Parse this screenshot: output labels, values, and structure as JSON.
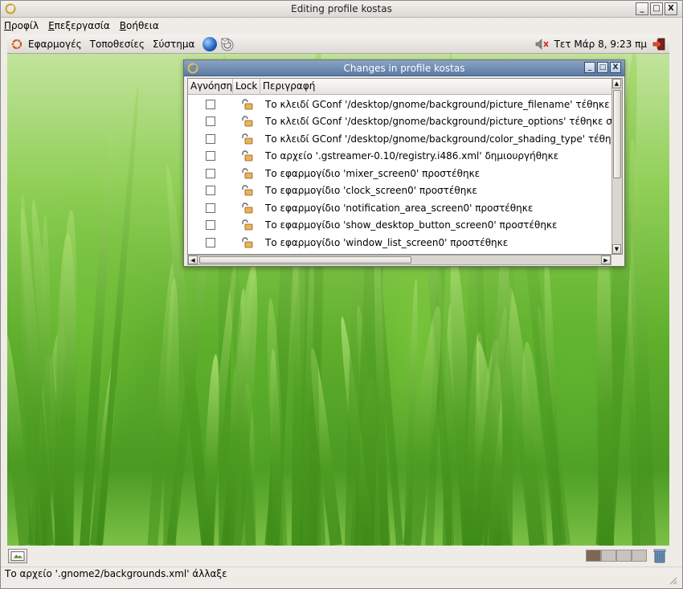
{
  "outer_window": {
    "title": "Editing profile kostas",
    "menu": [
      "Προφίλ",
      "Επεξεργασία",
      "Βοήθεια"
    ],
    "buttons": [
      "_",
      "□",
      "X"
    ]
  },
  "gnome_panel": {
    "menus": [
      "Εφαρμογές",
      "Τοποθεσίες",
      "Σύστημα"
    ],
    "clock": "Τετ Μάρ 8, 9:23 πμ"
  },
  "dialog": {
    "title": "Changes in profile kostas",
    "buttons": [
      "_",
      "□",
      "X"
    ],
    "columns": [
      "Αγνόηση",
      "Lock",
      "Περιγραφή"
    ],
    "rows": [
      {
        "ignored": false,
        "locked": false,
        "description": "Το κλειδί GConf '/desktop/gnome/background/picture_filename' τέθηκε στο '"
      },
      {
        "ignored": false,
        "locked": false,
        "description": "Το κλειδί GConf '/desktop/gnome/background/picture_options' τέθηκε στο '"
      },
      {
        "ignored": false,
        "locked": false,
        "description": "Το κλειδί GConf '/desktop/gnome/background/color_shading_type' τέθηκε σ"
      },
      {
        "ignored": false,
        "locked": false,
        "description": "Το αρχείο '.gstreamer-0.10/registry.i486.xml' δημιουργήθηκε"
      },
      {
        "ignored": false,
        "locked": false,
        "description": "Το εφαρμογίδιο 'mixer_screen0' προστέθηκε"
      },
      {
        "ignored": false,
        "locked": false,
        "description": "Το εφαρμογίδιο 'clock_screen0' προστέθηκε"
      },
      {
        "ignored": false,
        "locked": false,
        "description": "Το εφαρμογίδιο 'notification_area_screen0' προστέθηκε"
      },
      {
        "ignored": false,
        "locked": false,
        "description": "Το εφαρμογίδιο 'show_desktop_button_screen0' προστέθηκε"
      },
      {
        "ignored": false,
        "locked": false,
        "description": "Το εφαρμογίδιο 'window_list_screen0' προστέθηκε"
      }
    ]
  },
  "workspaces": {
    "count": 4,
    "active": 1
  },
  "status_bar": {
    "text": "Το αρχείο '.gnome2/backgrounds.xml' άλλαξε"
  },
  "colors": {
    "dialog_titlebar": "#5a7aa4",
    "window_bg": "#efebe7",
    "active_workspace": "#7f6755"
  }
}
